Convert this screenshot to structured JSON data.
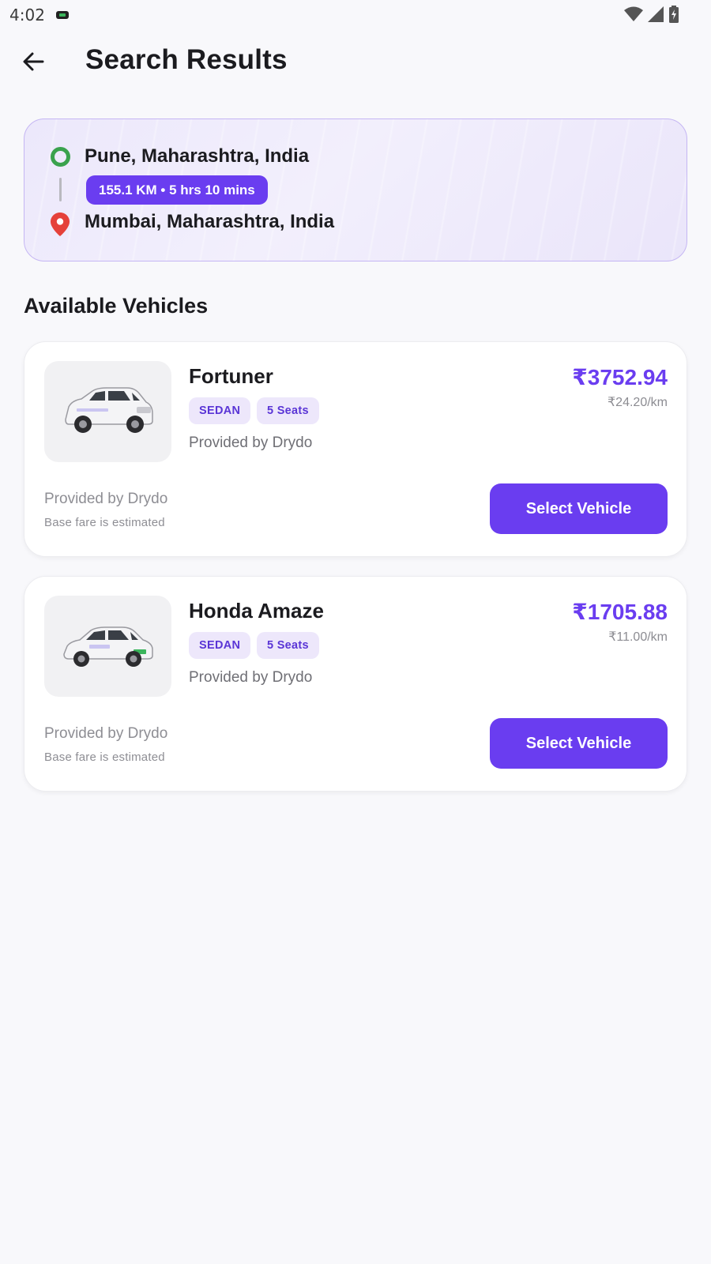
{
  "status_bar": {
    "time": "4:02",
    "icons": [
      "notification-icon",
      "wifi-icon",
      "signal-icon",
      "battery-charging-icon"
    ]
  },
  "header": {
    "title": "Search Results",
    "back_icon": "arrow-left-icon"
  },
  "route": {
    "origin": "Pune, Maharashtra, India",
    "destination": "Mumbai, Maharashtra, India",
    "trip_summary": "155.1 KM • 5 hrs 10 mins",
    "origin_icon": "origin-circle-icon",
    "destination_icon": "location-pin-icon"
  },
  "section": {
    "title": "Available Vehicles"
  },
  "vehicles": [
    {
      "name": "Fortuner",
      "type": "SEDAN",
      "seats": "5 Seats",
      "provider_line": "Provided by Drydo",
      "price": "₹3752.94",
      "per_km": "₹24.20/km",
      "footer_provider": "Provided by Drydo",
      "footer_note": "Base fare is estimated",
      "button_label": "Select Vehicle",
      "image_icon": "suv-icon"
    },
    {
      "name": "Honda Amaze",
      "type": "SEDAN",
      "seats": "5 Seats",
      "provider_line": "Provided by Drydo",
      "price": "₹1705.88",
      "per_km": "₹11.00/km",
      "footer_provider": "Provided by Drydo",
      "footer_note": "Base fare is estimated",
      "button_label": "Select Vehicle",
      "image_icon": "sedan-icon"
    }
  ],
  "colors": {
    "accent": "#6a3df0",
    "background": "#f8f8fb",
    "origin_green": "#3aa24d",
    "destination_red": "#e5413a",
    "tag_bg": "#ede7fb"
  }
}
